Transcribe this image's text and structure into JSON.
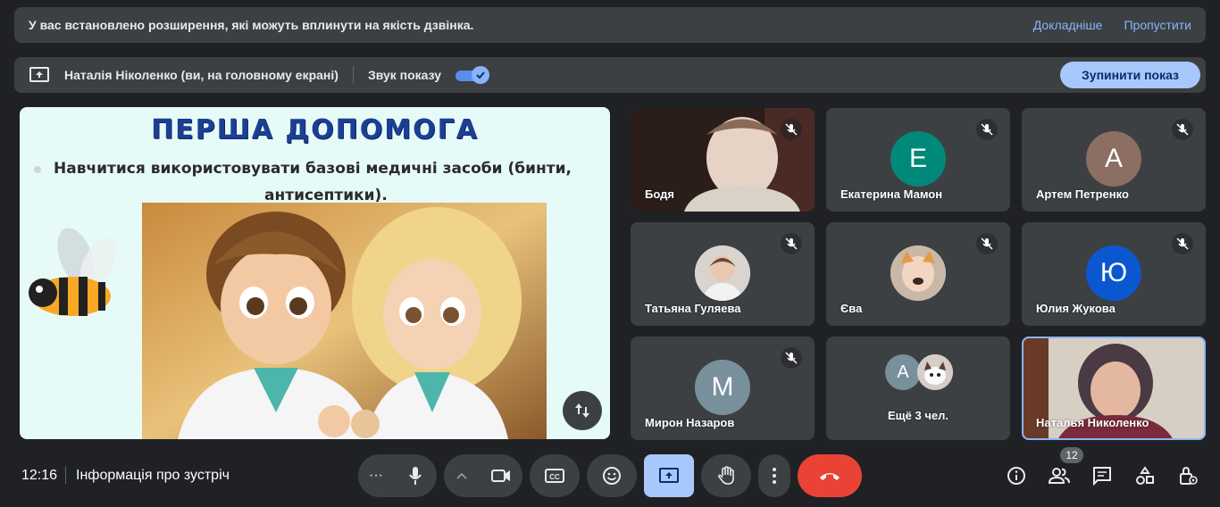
{
  "banner": {
    "text": "У вас встановлено розширення, які можуть вплинути на якість дзвінка.",
    "more_link": "Докладніше",
    "skip_link": "Пропустити"
  },
  "presenting": {
    "presenter": "Наталія Ніколенко (ви, на головному екрані)",
    "sound_label": "Звук показу",
    "sound_on": true,
    "stop_button": "Зупинити показ"
  },
  "slide": {
    "title": "ПЕРША ДОПОМОГА",
    "bullet_line1": "Навчитися використовувати базові медичні засоби (бинти,",
    "bullet_line2": "антисептики)."
  },
  "participants": [
    {
      "name": "Бодя",
      "type": "video",
      "muted": true
    },
    {
      "name": "Екатерина Мамон",
      "initial": "Е",
      "color": "#00897b",
      "muted": true
    },
    {
      "name": "Артем Петренко",
      "initial": "А",
      "color": "#8d6e63",
      "muted": true
    },
    {
      "name": "Татьяна Гуляева",
      "type": "photo",
      "muted": true
    },
    {
      "name": "Єва",
      "type": "photo",
      "muted": true
    },
    {
      "name": "Юлия Жукова",
      "initial": "Ю",
      "color": "#0b57d0",
      "muted": true
    },
    {
      "name": "Мирон Назаров",
      "initial": "М",
      "color": "#78909c",
      "muted": true
    },
    {
      "name": "Ещё 3 чел.",
      "initial": "А",
      "color": "#78909c"
    },
    {
      "name": "Наталья Николенко",
      "type": "video",
      "active": true
    }
  ],
  "bottom": {
    "time": "12:16",
    "meeting_info": "Інформація про зустріч",
    "people_count": "12"
  },
  "colors": {
    "background": "#202124",
    "surface": "#3c4043",
    "accent": "#8ab4f8",
    "stop_button": "#a8c7fa",
    "end_call": "#ea4335"
  }
}
